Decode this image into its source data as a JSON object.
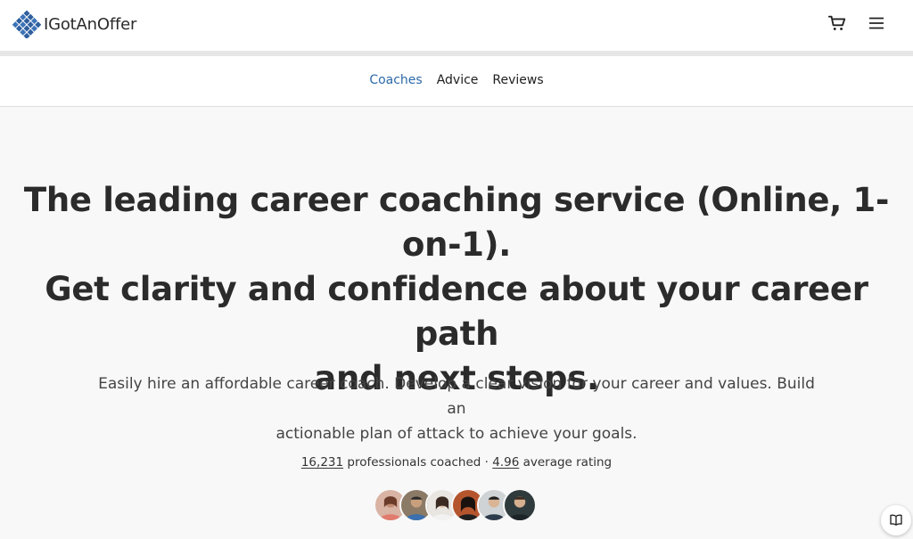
{
  "header": {
    "brand": "IGotAnOffer",
    "cart_icon": "cart-icon",
    "menu_icon": "menu-icon"
  },
  "nav": {
    "items": [
      {
        "label": "Coaches",
        "active": true
      },
      {
        "label": "Advice",
        "active": false
      },
      {
        "label": "Reviews",
        "active": false
      }
    ]
  },
  "hero": {
    "title_lines": [
      "The leading career coaching service (Online, 1-on-1).",
      "Get clarity and confidence about your career path",
      "and next steps."
    ],
    "subtitle_lines": [
      "Easily hire an affordable career coach. Develop a clear vision for your career and values. Build an",
      "actionable plan of attack to achieve your goals."
    ]
  },
  "stats": {
    "professionals_count": "16,231",
    "professionals_label": "professionals coached",
    "separator": "·",
    "rating": "4.96",
    "rating_label": "average rating"
  },
  "avatars": {
    "count": 6
  },
  "colors": {
    "accent": "#2d6aa8",
    "brand_blue": "#2f5f9e"
  },
  "help_widget": {
    "icon": "book-icon"
  }
}
